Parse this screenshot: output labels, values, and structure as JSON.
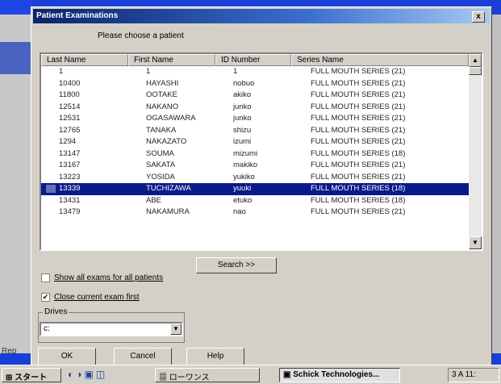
{
  "background": {
    "left_label": "Rep"
  },
  "dialog": {
    "title": "Patient Examinations",
    "close_label": "x",
    "prompt": "Please choose a patient",
    "columns": [
      "Last Name",
      "First Name",
      "ID Number",
      "Series Name"
    ],
    "rows": [
      [
        "1",
        "1",
        "1",
        "FULL MOUTH SERIES (21)"
      ],
      [
        "10400",
        "HAYASHI",
        "nobuo",
        "FULL MOUTH SERIES (21)"
      ],
      [
        "11800",
        "OOTAKE",
        "akiko",
        "FULL MOUTH SERIES (21)"
      ],
      [
        "12514",
        "NAKANO",
        "junko",
        "FULL MOUTH SERIES (21)"
      ],
      [
        "12531",
        "OGASAWARA",
        "junko",
        "FULL MOUTH SERIES (21)"
      ],
      [
        "12765",
        "TANAKA",
        "shizu",
        "FULL MOUTH SERIES (21)"
      ],
      [
        "1294",
        "NAKAZATO",
        "izumi",
        "FULL MOUTH SERIES (21)"
      ],
      [
        "13147",
        "SOUMA",
        "mizumi",
        "FULL MOUTH SERIES (18)"
      ],
      [
        "13167",
        "SAKATA",
        "makiko",
        "FULL MOUTH SERIES (21)"
      ],
      [
        "13223",
        "YOSIDA",
        "yukiko",
        "FULL MOUTH SERIES (21)"
      ],
      [
        "13339",
        "TUCHIZAWA",
        "yuuki",
        "FULL MOUTH SERIES (18)"
      ],
      [
        "13431",
        "ABE",
        "etuko",
        "FULL MOUTH SERIES (18)"
      ],
      [
        "13479",
        "NAKAMURA",
        "nao",
        "FULL MOUTH SERIES (21)"
      ]
    ],
    "selected_row": 10,
    "search_label": "Search >>",
    "show_all_label": "Show all exams for all patients",
    "close_current_label": "Close current exam first",
    "close_current_checked": "✔",
    "drives_label": "Drives",
    "drive_value": "c:",
    "ok_label": "OK",
    "cancel_label": "Cancel",
    "help_label": "Help"
  },
  "taskbar": {
    "start_label": "スタート",
    "item1": "ローワンス",
    "item2": "Schick Technologies...",
    "tray": "3 A  11:"
  }
}
